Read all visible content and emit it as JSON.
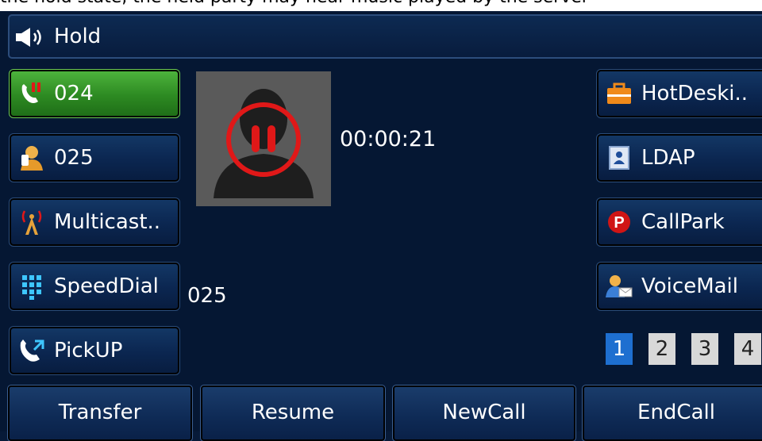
{
  "header": {
    "strip_text": "the hold state, the held party may hear music played by the server"
  },
  "titlebar": {
    "icon": "speaker-icon",
    "title": "Hold"
  },
  "lines": [
    {
      "label": "024",
      "icon": "phone-hold-icon",
      "active": true
    },
    {
      "label": "025",
      "icon": "user-contact-icon",
      "active": false
    },
    {
      "label": "Multicast..",
      "icon": "antenna-icon",
      "active": false
    },
    {
      "label": "SpeedDial",
      "icon": "keypad-icon",
      "active": false
    },
    {
      "label": "PickUP",
      "icon": "phone-pickup-icon",
      "active": false
    }
  ],
  "call": {
    "timer": "00:00:21",
    "remote_number": "025",
    "avatar_icon": "person-silhouette-icon",
    "status_icon": "pause-icon"
  },
  "features": [
    {
      "label": "HotDeski..",
      "icon": "briefcase-icon"
    },
    {
      "label": "LDAP",
      "icon": "directory-icon"
    },
    {
      "label": "CallPark",
      "icon": "park-icon"
    },
    {
      "label": "VoiceMail",
      "icon": "voicemail-icon"
    }
  ],
  "pager": {
    "pages": [
      "1",
      "2",
      "3",
      "4"
    ],
    "current": "1"
  },
  "softkeys": [
    "Transfer",
    "Resume",
    "NewCall",
    "EndCall"
  ],
  "colors": {
    "background": "#051733",
    "active_line": "#3aa02e",
    "pause_red": "#e01818",
    "page_active": "#1e6fd0"
  }
}
